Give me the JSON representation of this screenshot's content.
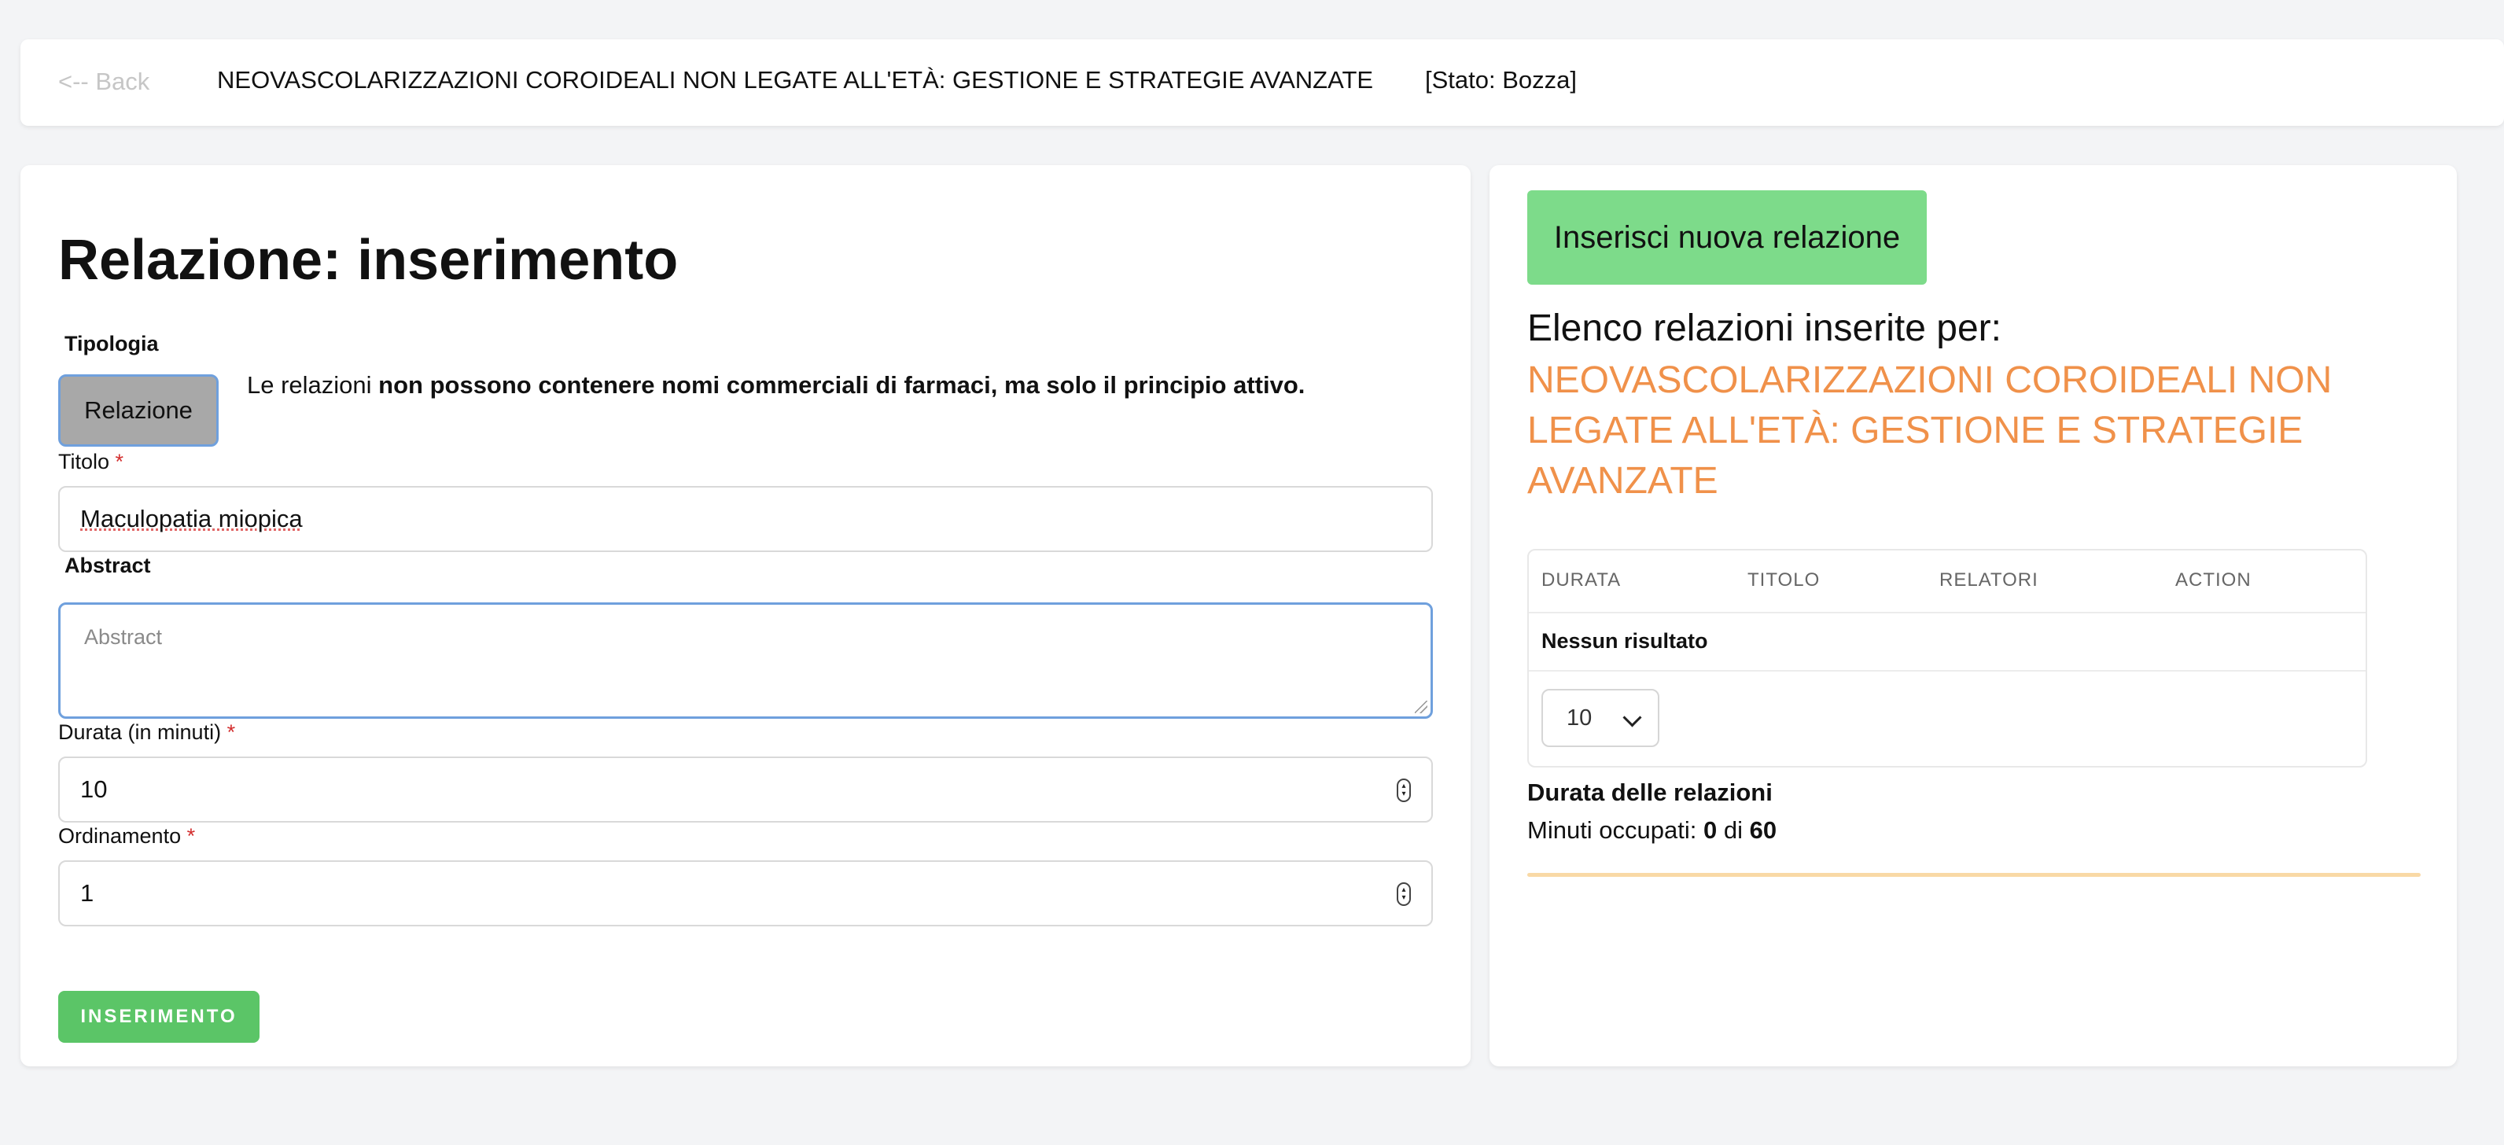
{
  "header": {
    "back_label": "<-- Back",
    "course_title": "NEOVASCOLARIZZAZIONI COROIDEALI NON LEGATE ALL'ETÀ: GESTIONE E STRATEGIE AVANZATE",
    "status": "[Stato: Bozza]"
  },
  "form": {
    "heading": "Relazione: inserimento",
    "tipologia_label": "Tipologia",
    "tipologia_value": "Relazione",
    "notice_prefix": "Le relazioni ",
    "notice_bold": "non possono contenere nomi commerciali di farmaci, ma solo il principio attivo.",
    "titolo_label": "Titolo",
    "titolo_value": "Maculopatia miopica",
    "abstract_label": "Abstract",
    "abstract_placeholder": "Abstract",
    "durata_label": "Durata (in minuti)",
    "durata_value": "10",
    "ordinamento_label": "Ordinamento",
    "ordinamento_value": "1",
    "required_mark": "*",
    "submit_label": "INSERIMENTO"
  },
  "list": {
    "new_button": "Inserisci nuova relazione",
    "heading": "Elenco relazioni inserite per:",
    "course_title": "NEOVASCOLARIZZAZIONI COROIDEALI NON LEGATE ALL'ETÀ: GESTIONE E STRATEGIE AVANZATE",
    "columns": [
      "DURATA",
      "TITOLO",
      "RELATORI",
      "ACTION"
    ],
    "empty_text": "Nessun risultato",
    "page_size": "10"
  },
  "duration": {
    "title": "Durata delle relazioni",
    "used_label": "Minuti occupati: ",
    "used": "0",
    "of_label": " di ",
    "total": "60",
    "progress_fraction": 0
  },
  "colors": {
    "accent_orange": "#f0914a",
    "button_green": "#5bc567",
    "new_button_green": "#7ddb8a"
  }
}
